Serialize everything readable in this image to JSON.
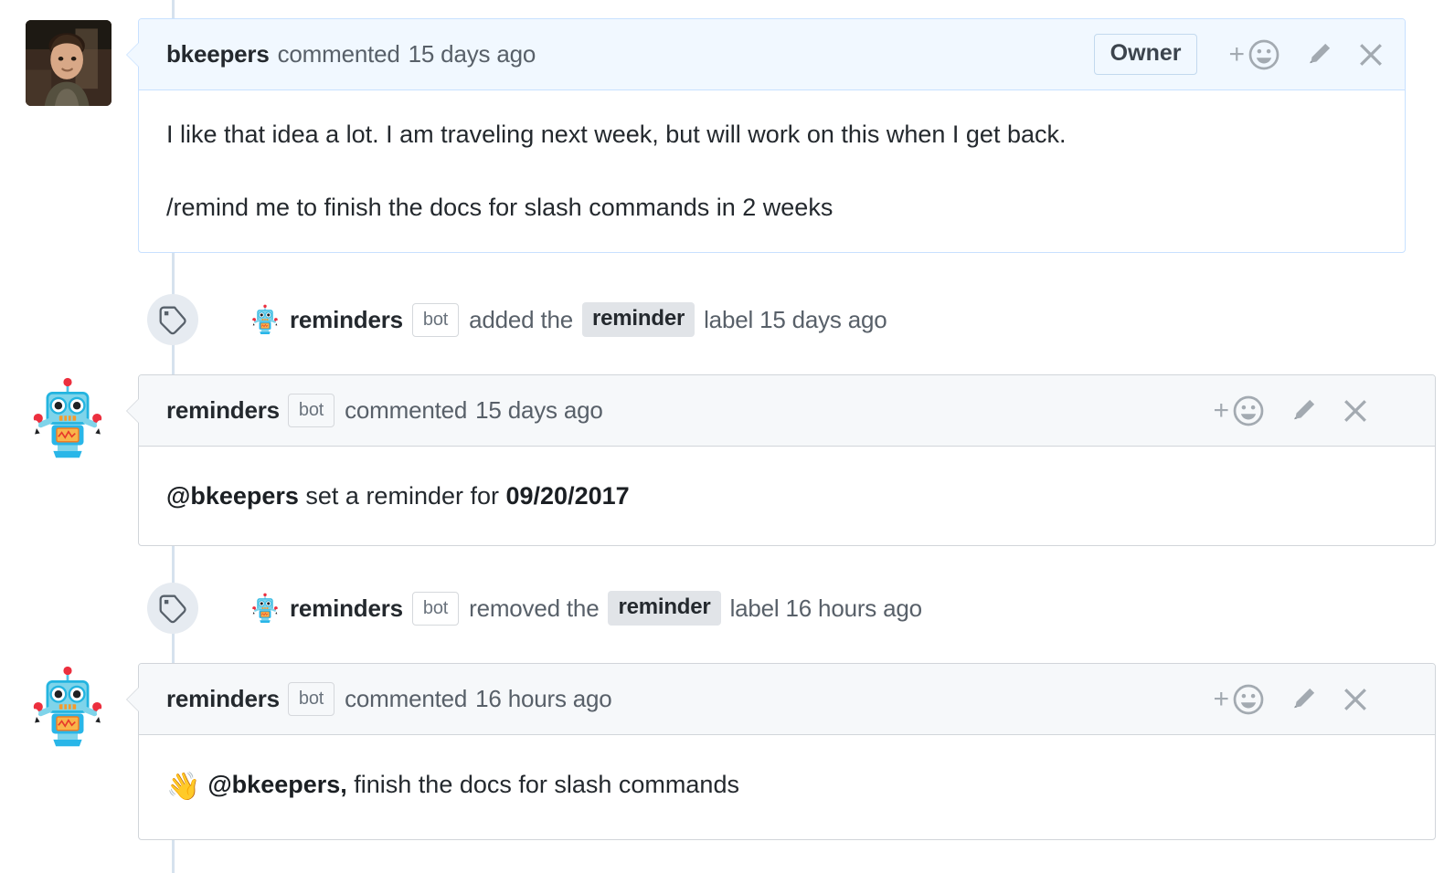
{
  "timeline": {
    "items": [
      {
        "type": "comment",
        "author": "bkeepers",
        "action": "commented",
        "timestamp": "15 days ago",
        "badge": "Owner",
        "avatar_kind": "photo",
        "body_paragraphs": [
          "I like that idea a lot. I am traveling next week, but will work on this when I get back.",
          "/remind me to finish the docs for slash commands in 2 weeks"
        ]
      },
      {
        "type": "event",
        "icon": "tag-icon",
        "actor": "reminders",
        "actor_badge": "bot",
        "action_text": "added the",
        "label": "reminder",
        "suffix": "label 15 days ago"
      },
      {
        "type": "comment",
        "author": "reminders",
        "author_badge": "bot",
        "action": "commented",
        "timestamp": "15 days ago",
        "avatar_kind": "robot",
        "body_rich": {
          "mention": "@bkeepers",
          "middle": " set a reminder for ",
          "date": "09/20/2017"
        }
      },
      {
        "type": "event",
        "icon": "tag-icon",
        "actor": "reminders",
        "actor_badge": "bot",
        "action_text": "removed the",
        "label": "reminder",
        "suffix": "label 16 hours ago"
      },
      {
        "type": "comment",
        "author": "reminders",
        "author_badge": "bot",
        "action": "commented",
        "timestamp": "16 hours ago",
        "avatar_kind": "robot",
        "body_rich": {
          "emoji": "👋",
          "mention": "@bkeepers,",
          "middle": " finish the docs for slash commands"
        }
      }
    ]
  },
  "actions": {
    "add_reaction_plus": "+",
    "add_reaction_label": "add reaction",
    "edit_label": "edit comment",
    "close_label": "close"
  },
  "colors": {
    "blue_header_bg": "#f1f8ff",
    "blue_border": "#c8e1ff",
    "gray_header_bg": "#f6f8fa",
    "gray_border": "#d1d5da",
    "label_chip_bg": "#e1e4e8",
    "timeline_line": "#d6e2ee",
    "muted_text": "#586069"
  }
}
